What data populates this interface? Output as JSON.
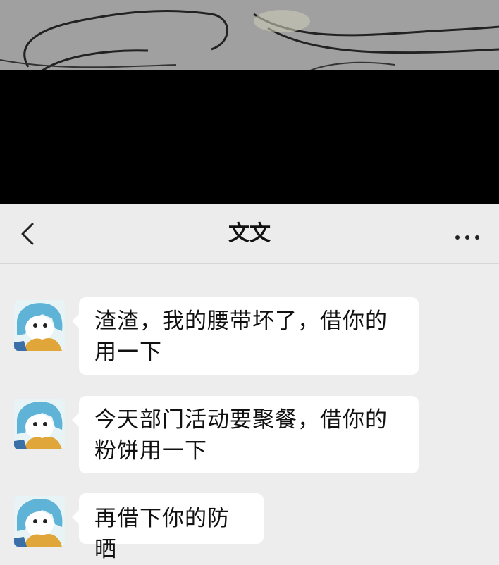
{
  "chat": {
    "title": "文文",
    "back_icon": "chevron-left-icon",
    "more_icon": "more-dots-icon"
  },
  "messages": [
    {
      "sender": "文文",
      "text": "渣渣，我的腰带坏了，借你的用一下"
    },
    {
      "sender": "文文",
      "text": "今天部门活动要聚餐，借你的粉饼用一下"
    },
    {
      "sender": "文文",
      "text": "再借下你的防晒"
    }
  ],
  "colors": {
    "nav_background": "#ececec",
    "chat_background": "#ededed",
    "bubble_background": "#ffffff",
    "avatar_hair": "#5fb3d6",
    "avatar_body": "#e0a63a"
  }
}
